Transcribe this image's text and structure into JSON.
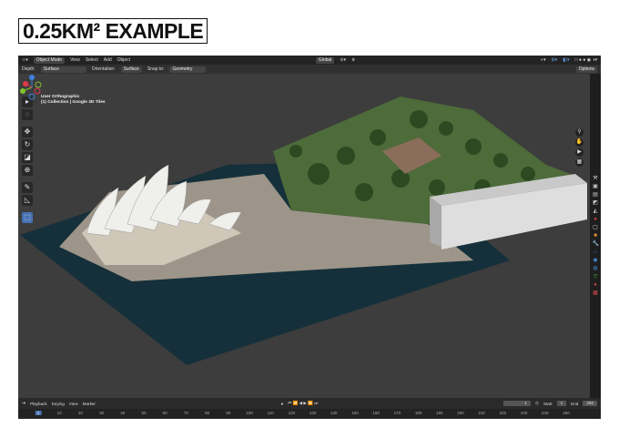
{
  "title": "0.25KM² EXAMPLE",
  "header": {
    "editor_icon": "viewport-icon",
    "mode": "Object Mode",
    "menus": [
      "View",
      "Select",
      "Add",
      "Object"
    ],
    "transform": "Global",
    "options": "Options"
  },
  "toolsettings": {
    "depth_label": "Depth:",
    "depth": "Surface",
    "orientation_label": "Orientation:",
    "orientation": "Surface",
    "snap_label": "Snap to:",
    "snap": "Geometry"
  },
  "viewport": {
    "view_name": "User Orthographic",
    "collection": "(1) Collection | Google 3D Tiles"
  },
  "gizmo": {
    "x": "X",
    "y": "Y",
    "z": "Z",
    "x_color": "#e2394b",
    "y_color": "#7fc22b",
    "z_color": "#3b82e0"
  },
  "timeline": {
    "menus": [
      "Playback",
      "Keying",
      "View",
      "Marker"
    ],
    "current_frame": "1",
    "start_label": "Start",
    "start": "1",
    "end_label": "End",
    "end": "250",
    "ticks": [
      "1",
      "10",
      "20",
      "30",
      "40",
      "50",
      "60",
      "70",
      "80",
      "90",
      "100",
      "110",
      "120",
      "130",
      "140",
      "150",
      "160",
      "170",
      "180",
      "190",
      "200",
      "210",
      "220",
      "230",
      "240",
      "250"
    ]
  }
}
